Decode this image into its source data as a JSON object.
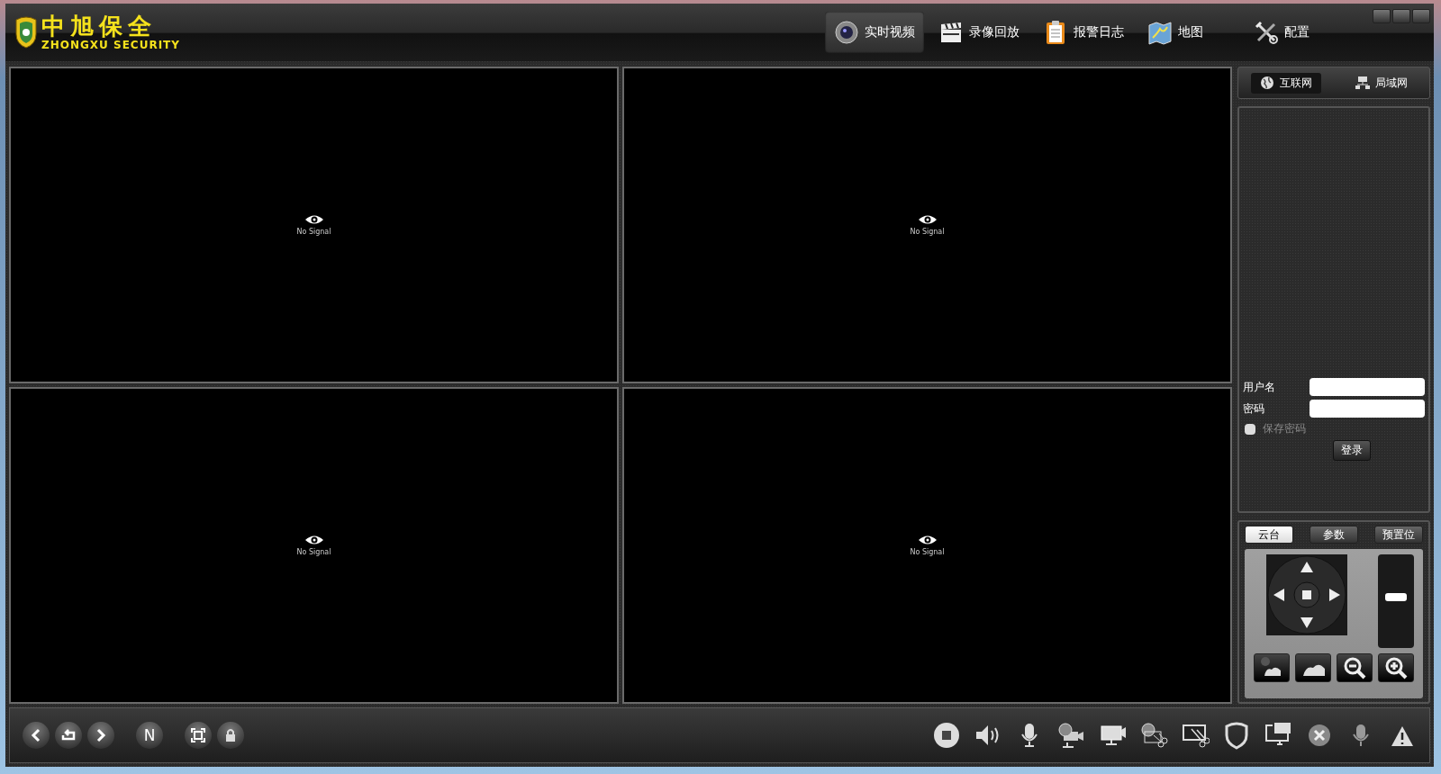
{
  "logo": {
    "title": "中旭保全",
    "subtitle": "ZHONGXU SECURITY"
  },
  "nav_tabs": [
    {
      "label": "实时视频",
      "selected": true
    },
    {
      "label": "录像回放",
      "selected": false
    },
    {
      "label": "报警日志",
      "selected": false
    },
    {
      "label": "地图",
      "selected": false
    },
    {
      "label": "配置",
      "selected": false
    }
  ],
  "video_panes": [
    {
      "status": "No Signal"
    },
    {
      "status": "No Signal"
    },
    {
      "status": "No Signal"
    },
    {
      "status": "No Signal"
    }
  ],
  "network_tabs": [
    {
      "label": "互联网",
      "selected": true
    },
    {
      "label": "局域网",
      "selected": false
    }
  ],
  "login": {
    "username_label": "用户名",
    "password_label": "密码",
    "remember": {
      "label": "保存密码",
      "checked": false
    },
    "button": "登录"
  },
  "ptz": {
    "tabs": [
      {
        "label": "云台",
        "selected": true
      },
      {
        "label": "参数",
        "selected": false
      },
      {
        "label": "预置位",
        "selected": false
      }
    ],
    "zoom": {
      "level": 0.55
    }
  },
  "toolbar": {
    "n_button": "N"
  }
}
